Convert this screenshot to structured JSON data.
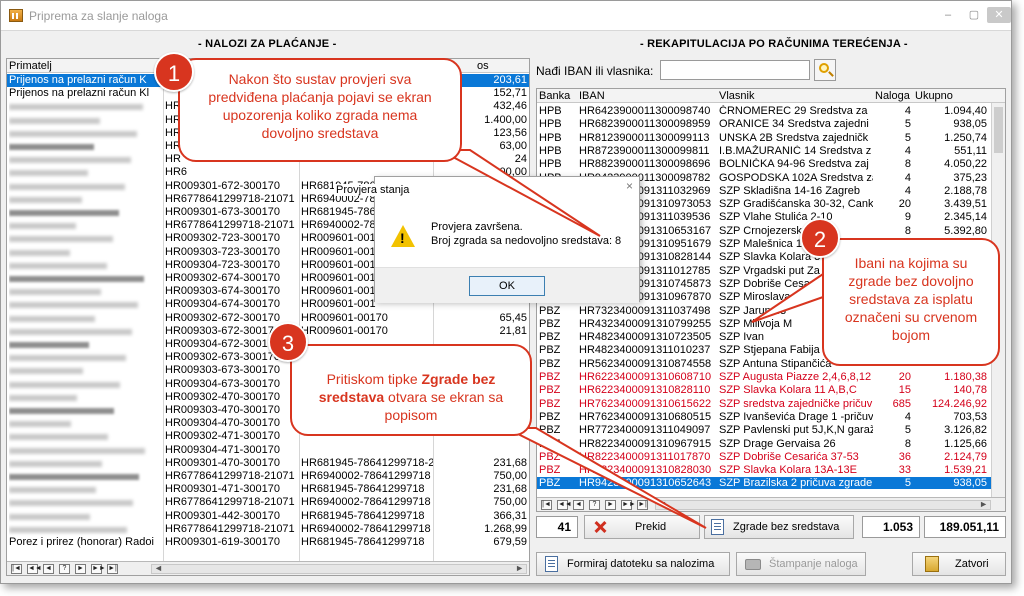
{
  "window": {
    "title": "Priprema za slanje naloga",
    "controls": {
      "minimize": "–",
      "maximize": "▢",
      "close": "✕"
    }
  },
  "left_section_title": "- NALOZI ZA PLAĆANJE -",
  "right_section_title": "- REKAPITULACIJA PO RAČUNIMA TEREĆENJA -",
  "left_grid": {
    "headers": [
      "Primatelj",
      "",
      "",
      "os"
    ],
    "rows": [
      {
        "primatelj": "Prijenos na prelazni račun K",
        "iban": "",
        "iban2": "",
        "iznos": "203,61",
        "selected": true
      },
      {
        "primatelj": "Prijenos na prelazni račun Kl",
        "iban": "",
        "iban2": "",
        "iznos": "152,71"
      },
      {
        "primatelj": "",
        "iban": "HR",
        "iban2": "",
        "iznos": "432,46"
      },
      {
        "primatelj": "",
        "iban": "HR",
        "iban2": "",
        "iznos": "1.400,00"
      },
      {
        "primatelj": "",
        "iban": "HR",
        "iban2": "",
        "iznos": "123,56"
      },
      {
        "primatelj": "",
        "iban": "HR",
        "iban2": "",
        "iznos": "63,00"
      },
      {
        "primatelj": "",
        "iban": "HR",
        "iban2": "",
        "iznos": "24"
      },
      {
        "primatelj": "",
        "iban": "HR6",
        "iban2": "",
        "iznos": "800,00"
      },
      {
        "primatelj": "",
        "iban": "HR009301-672-300170",
        "iban2": "HR681945-786",
        "iznos": ""
      },
      {
        "primatelj": "",
        "iban": "HR6778641299718-21071",
        "iban2": "HR6940002-784",
        "iznos": ""
      },
      {
        "primatelj": "",
        "iban": "HR009301-673-300170",
        "iban2": "HR681945-786",
        "iznos": ""
      },
      {
        "primatelj": "",
        "iban": "HR6778641299718-21071",
        "iban2": "HR6940002-784",
        "iznos": ""
      },
      {
        "primatelj": "",
        "iban": "HR009302-723-300170",
        "iban2": "HR009601-001",
        "iznos": ""
      },
      {
        "primatelj": "",
        "iban": "HR009303-723-300170",
        "iban2": "HR009601-001",
        "iznos": ""
      },
      {
        "primatelj": "",
        "iban": "HR009304-723-300170",
        "iban2": "HR009601-001",
        "iznos": ""
      },
      {
        "primatelj": "",
        "iban": "HR009302-674-300170",
        "iban2": "HR009601-001",
        "iznos": ""
      },
      {
        "primatelj": "",
        "iban": "HR009303-674-300170",
        "iban2": "HR009601-001",
        "iznos": ""
      },
      {
        "primatelj": "",
        "iban": "HR009304-674-300170",
        "iban2": "HR009601-001",
        "iznos": ""
      },
      {
        "primatelj": "",
        "iban": "HR009302-672-300170",
        "iban2": "HR009601-00170",
        "iznos": "65,45"
      },
      {
        "primatelj": "",
        "iban": "HR009303-672-300170",
        "iban2": "HR009601-00170",
        "iznos": "21,81"
      },
      {
        "primatelj": "",
        "iban": "HR009304-672-300170",
        "iban2": "",
        "iznos": ""
      },
      {
        "primatelj": "",
        "iban": "HR009302-673-300170",
        "iban2": "",
        "iznos": ""
      },
      {
        "primatelj": "",
        "iban": "HR009303-673-300170",
        "iban2": "",
        "iznos": ""
      },
      {
        "primatelj": "",
        "iban": "HR009304-673-300170",
        "iban2": "",
        "iznos": ""
      },
      {
        "primatelj": "",
        "iban": "HR009302-470-300170",
        "iban2": "",
        "iznos": ""
      },
      {
        "primatelj": "",
        "iban": "HR009303-470-300170",
        "iban2": "",
        "iznos": ""
      },
      {
        "primatelj": "",
        "iban": "HR009304-470-300170",
        "iban2": "",
        "iznos": ""
      },
      {
        "primatelj": "",
        "iban": "HR009302-471-300170",
        "iban2": "",
        "iznos": ""
      },
      {
        "primatelj": "",
        "iban": "HR009304-471-300170",
        "iban2": "",
        "iznos": ""
      },
      {
        "primatelj": "",
        "iban": "HR009301-470-300170",
        "iban2": "HR681945-78641299718-2",
        "iznos": "231,68"
      },
      {
        "primatelj": "",
        "iban": "HR6778641299718-21071",
        "iban2": "HR6940002-78641299718",
        "iznos": "750,00"
      },
      {
        "primatelj": "",
        "iban": "HR009301-471-300170",
        "iban2": "HR681945-78641299718",
        "iznos": "231,68"
      },
      {
        "primatelj": "",
        "iban": "HR6778641299718-21071",
        "iban2": "HR6940002-78641299718",
        "iznos": "750,00"
      },
      {
        "primatelj": "",
        "iban": "HR009301-442-300170",
        "iban2": "HR681945-78641299718",
        "iznos": "366,31"
      },
      {
        "primatelj": "",
        "iban": "HR6778641299718-21071",
        "iban2": "HR6940002-78641299718",
        "iznos": "1.268,99"
      },
      {
        "primatelj": "Porez i prirez (honorar) Radoi",
        "iban": "HR009301-619-300170",
        "iban2": "HR681945-78641299718",
        "iznos": "679,59"
      }
    ]
  },
  "search": {
    "label": "Nađi IBAN ili vlasnika:",
    "value": "",
    "placeholder": ""
  },
  "right_grid": {
    "headers": {
      "banka": "Banka",
      "iban": "IBAN",
      "vlasnik": "Vlasnik",
      "naloga": "Naloga",
      "ukupno": "Ukupno"
    },
    "rows": [
      {
        "banka": "HPB",
        "iban": "HR6423900011300098740",
        "vlasnik": "ČRNOMEREC 29  Sredstva za",
        "naloga": "4",
        "ukupno": "1.094,40"
      },
      {
        "banka": "HPB",
        "iban": "HR6823900011300098959",
        "vlasnik": "ORANICE 34  Sredstva zajedni",
        "naloga": "5",
        "ukupno": "938,05"
      },
      {
        "banka": "HPB",
        "iban": "HR8123900011300099113",
        "vlasnik": "UNSKA 2B  Sredstva zajedničk",
        "naloga": "5",
        "ukupno": "1.250,74"
      },
      {
        "banka": "HPB",
        "iban": "HR8723900011300099811",
        "vlasnik": "I.B.MAŽURANIĆ 14  Sredstva z",
        "naloga": "4",
        "ukupno": "551,11"
      },
      {
        "banka": "HPB",
        "iban": "HR8823900011300098696",
        "vlasnik": "BOLNIČKA 94-96  Sredstva zaj",
        "naloga": "8",
        "ukupno": "4.050,22"
      },
      {
        "banka": "HPB",
        "iban": "HR9423900011300098782",
        "vlasnik": "GOSPODSKA 102A  Sredstva za",
        "naloga": "4",
        "ukupno": "375,23"
      },
      {
        "banka": "PBZ",
        "iban": "HR6223400091311032969",
        "vlasnik": "SZP Skladišna 14-16 Zagreb",
        "naloga": "4",
        "ukupno": "2.188,78"
      },
      {
        "banka": "PBZ",
        "iban": "HR6323400091310973053",
        "vlasnik": "SZP Gradišćanska 30-32, Cank",
        "naloga": "20",
        "ukupno": "3.439,51"
      },
      {
        "banka": "PBZ",
        "iban": "HR6323400091311039536",
        "vlasnik": "SZP Vlahe Stulića 2-10",
        "naloga": "9",
        "ukupno": "2.345,14"
      },
      {
        "banka": "PBZ",
        "iban": "HR6623400091310653167",
        "vlasnik": "SZP Crnojezerska",
        "naloga": "8",
        "ukupno": "5.392,80"
      },
      {
        "banka": "PBZ",
        "iban": "HR6923400091310951679",
        "vlasnik": "SZP Malešnica 1",
        "naloga": "",
        "ukupno": ""
      },
      {
        "banka": "PBZ",
        "iban": "HR6923400091310828144",
        "vlasnik": "SZP Slavka Kolara 3",
        "naloga": "",
        "ukupno": ""
      },
      {
        "banka": "PBZ",
        "iban": "HR7023400091311012785",
        "vlasnik": "SZP Vrgadski put Za",
        "naloga": "",
        "ukupno": ""
      },
      {
        "banka": "PBZ",
        "iban": "HR7123400091310745873",
        "vlasnik": "SZP Dobriše Cesaric",
        "naloga": "",
        "ukupno": ""
      },
      {
        "banka": "PBZ",
        "iban": "HR7223400091310967870",
        "vlasnik": "SZP Miroslava Milić",
        "naloga": "",
        "ukupno": ""
      },
      {
        "banka": "PBZ",
        "iban": "HR7323400091311037498",
        "vlasnik": "SZP Jarun 43",
        "naloga": "",
        "ukupno": ""
      },
      {
        "banka": "PBZ",
        "iban": "HR4323400091310799255",
        "vlasnik": "SZP Milivoja M",
        "naloga": "",
        "ukupno": ""
      },
      {
        "banka": "PBZ",
        "iban": "HR4823400091310723505",
        "vlasnik": "SZP Ivan",
        "naloga": "",
        "ukupno": ""
      },
      {
        "banka": "PBZ",
        "iban": "HR4823400091311010237",
        "vlasnik": "SZP Stjepana Fabija",
        "naloga": "",
        "ukupno": ""
      },
      {
        "banka": "PBZ",
        "iban": "HR5623400091310874558",
        "vlasnik": "SZP Antuna Stipančića",
        "naloga": "",
        "ukupno": ""
      },
      {
        "banka": "PBZ",
        "iban": "HR6223400091310608710",
        "vlasnik": "SZP Augusta Piazze 2,4,6,8,12",
        "naloga": "20",
        "ukupno": "1.180,38",
        "red": true
      },
      {
        "banka": "PBZ",
        "iban": "HR6223400091310828110",
        "vlasnik": "SZP Slavka Kolara 11 A,B,C",
        "naloga": "15",
        "ukupno": "140,78",
        "red": true
      },
      {
        "banka": "PBZ",
        "iban": "HR7623400091310615622",
        "vlasnik": "SZP sredstva zajedničke pričuv",
        "naloga": "685",
        "ukupno": "124.246,92",
        "red": true
      },
      {
        "banka": "PBZ",
        "iban": "HR7623400091310680515",
        "vlasnik": "SZP Ivanševića Drage 1 -pričuv",
        "naloga": "4",
        "ukupno": "703,53"
      },
      {
        "banka": "PBZ",
        "iban": "HR7723400091311049097",
        "vlasnik": "SZP Pavlenski put 5J,K,N garaž",
        "naloga": "5",
        "ukupno": "3.126,82"
      },
      {
        "banka": "PBZ",
        "iban": "HR8223400091310967915",
        "vlasnik": "SZP Drage Gervaisa 26",
        "naloga": "8",
        "ukupno": "1.125,66"
      },
      {
        "banka": "PBZ",
        "iban": "HR8223400091311017870",
        "vlasnik": "SZP Dobriše Cesarića 37-53",
        "naloga": "36",
        "ukupno": "2.124,79",
        "red": true
      },
      {
        "banka": "PBZ",
        "iban": "HR8823400091310828030",
        "vlasnik": "SZP Slavka Kolara 13A-13E",
        "naloga": "33",
        "ukupno": "1.539,21",
        "red": true
      },
      {
        "banka": "PBZ",
        "iban": "HR9423400091310652643",
        "vlasnik": "SZP Brazilska 2 pričuva zgrade",
        "naloga": "5",
        "ukupno": "938,05",
        "selected": true
      }
    ]
  },
  "totals": {
    "count": "41",
    "naloga": "1.053",
    "ukupno": "189.051,11"
  },
  "buttons": {
    "prekid": "Prekid",
    "zgrade_bez_sredstava": "Zgrade bez sredstava",
    "formiraj": "Formiraj datoteku sa nalozima",
    "stampanje": "Štampanje naloga",
    "zatvori": "Zatvori"
  },
  "nav_glyphs": [
    "|◄",
    "◄◄",
    "◄",
    "?",
    "►",
    "►►",
    "►|"
  ],
  "dialog": {
    "title_fragment": "Provjera stanja",
    "close": "×",
    "message_line1": "Provjera završena.",
    "message_line2": "Broj zgrada sa nedovoljno sredstava: 8",
    "ok": "OK"
  },
  "callouts": [
    {
      "number": "1",
      "text": "Nakon što sustav provjeri sva predviđena plaćanja pojavi se ekran upozorenja koliko zgrada nema dovoljno sredstava"
    },
    {
      "number": "2",
      "text": "Ibani na kojima su zgrade bez dovoljno sredstava za isplatu označeni su crvenom bojom"
    },
    {
      "number": "3",
      "text_before": "Pritiskom tipke ",
      "text_bold": "Zgrade bez sredstava",
      "text_after": " otvara se ekran sa popisom"
    }
  ],
  "colors": {
    "callout_red": "#d8351f",
    "selection_blue": "#0a78d7",
    "alert_red_text": "#d4001a"
  }
}
